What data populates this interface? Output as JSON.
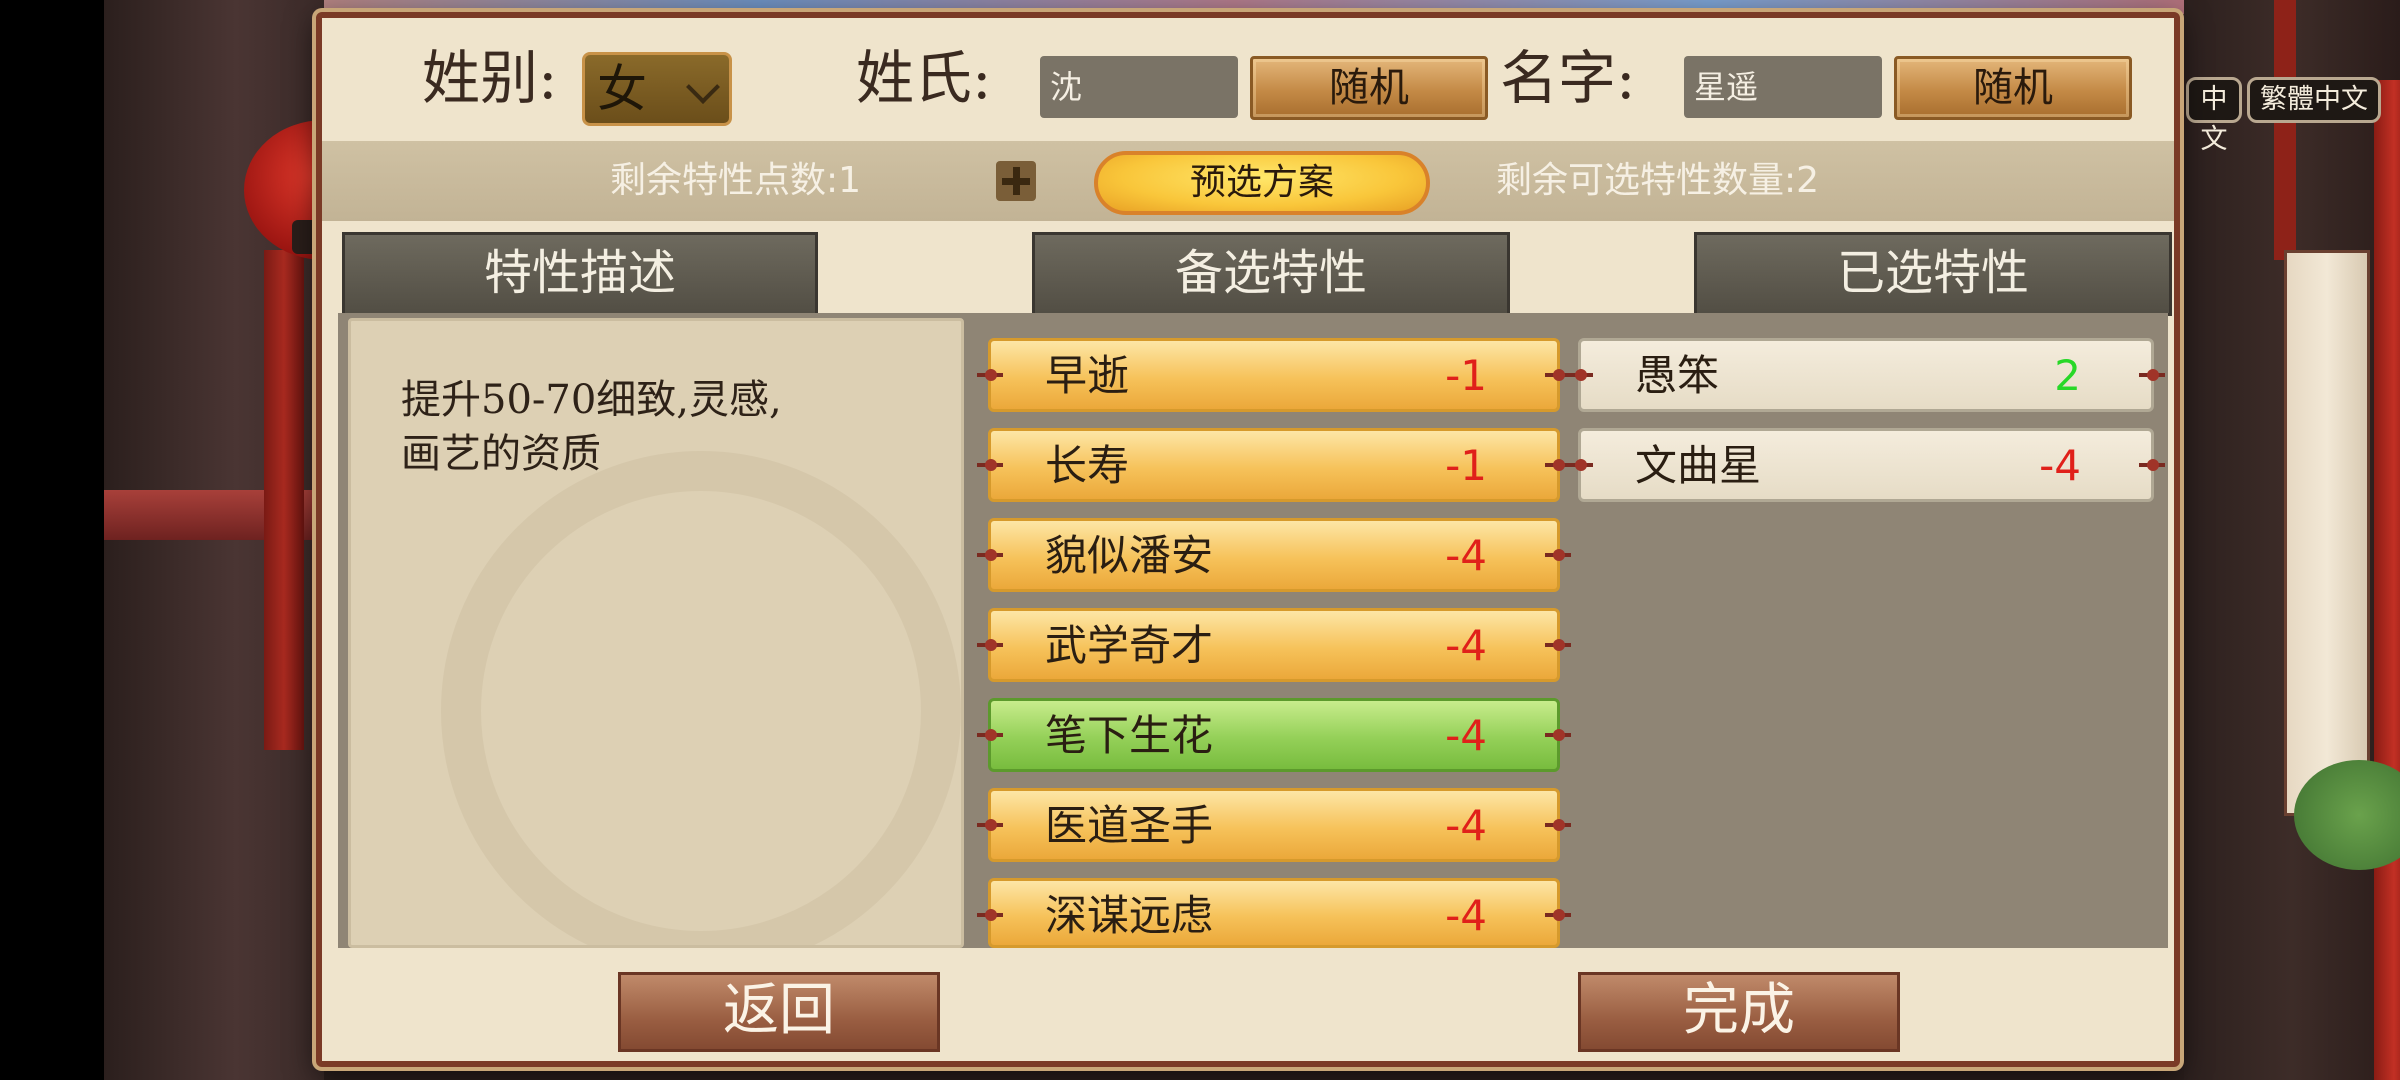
{
  "language": {
    "simplified": "中文",
    "traditional": "繁體中文"
  },
  "form": {
    "gender_label": "姓别:",
    "gender_value": "女",
    "surname_label": "姓氏:",
    "surname_value": "沈",
    "random_label": "随机",
    "given_name_label": "名字:",
    "given_name_value": "星遥"
  },
  "points": {
    "remaining_points_text": "剩余特性点数:1",
    "preset_label": "预选方案",
    "remaining_selectable_text": "剩余可选特性数量:2"
  },
  "headers": {
    "description": "特性描述",
    "candidates": "备选特性",
    "selected": "已选特性"
  },
  "description_text": "提升50-70细致,灵感,\n画艺的资质",
  "candidate_traits": [
    {
      "name": "早逝",
      "cost": "-1",
      "highlighted": false
    },
    {
      "name": "长寿",
      "cost": "-1",
      "highlighted": false
    },
    {
      "name": "貌似潘安",
      "cost": "-4",
      "highlighted": false
    },
    {
      "name": "武学奇才",
      "cost": "-4",
      "highlighted": false
    },
    {
      "name": "笔下生花",
      "cost": "-4",
      "highlighted": true
    },
    {
      "name": "医道圣手",
      "cost": "-4",
      "highlighted": false
    },
    {
      "name": "深谋远虑",
      "cost": "-4",
      "highlighted": false
    }
  ],
  "selected_traits": [
    {
      "name": "愚笨",
      "cost": "2"
    },
    {
      "name": "文曲星",
      "cost": "-4"
    }
  ],
  "buttons": {
    "back": "返回",
    "done": "完成"
  },
  "colors": {
    "negative_cost": "#e0201a",
    "positive_cost": "#28d828",
    "highlight_green": "#94d058",
    "trait_gold": "#f6c25a"
  }
}
